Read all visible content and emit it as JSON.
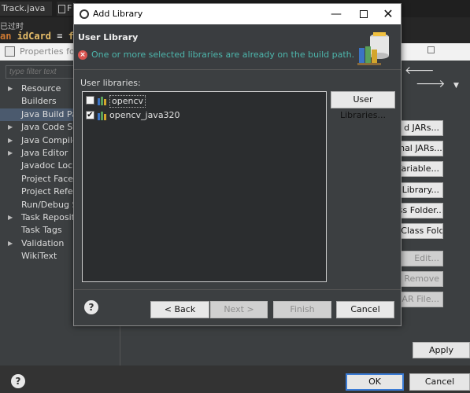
{
  "editor": {
    "tabs": [
      "Track.java",
      "F"
    ],
    "deprecated_text": "已过时",
    "code": {
      "keyword": "an",
      "identifier": "idCard",
      "operator": "=",
      "trail": "f"
    }
  },
  "properties_window": {
    "title": "Properties for",
    "filter_placeholder": "type filter text",
    "tree_items": [
      {
        "label": "Resource",
        "expandable": true,
        "selected": false
      },
      {
        "label": "Builders",
        "expandable": false,
        "selected": false
      },
      {
        "label": "Java Build Path",
        "expandable": false,
        "selected": true
      },
      {
        "label": "Java Code Style",
        "expandable": true,
        "selected": false
      },
      {
        "label": "Java Compiler",
        "expandable": true,
        "selected": false
      },
      {
        "label": "Java Editor",
        "expandable": true,
        "selected": false
      },
      {
        "label": "Javadoc Location",
        "expandable": false,
        "selected": false
      },
      {
        "label": "Project Facets",
        "expandable": false,
        "selected": false
      },
      {
        "label": "Project References",
        "expandable": false,
        "selected": false
      },
      {
        "label": "Run/Debug Settings",
        "expandable": false,
        "selected": false
      },
      {
        "label": "Task Repository",
        "expandable": true,
        "selected": false
      },
      {
        "label": "Task Tags",
        "expandable": false,
        "selected": false
      },
      {
        "label": "Validation",
        "expandable": true,
        "selected": false
      },
      {
        "label": "WikiText",
        "expandable": false,
        "selected": false
      }
    ],
    "side_buttons": [
      {
        "label": "d JARs...",
        "disabled": false
      },
      {
        "label": "ernal JARs...",
        "disabled": false
      },
      {
        "label": "Variable...",
        "disabled": false
      },
      {
        "label": "Library...",
        "disabled": false
      },
      {
        "label": "lass Folder...",
        "disabled": false
      },
      {
        "label": "al Class Folder...",
        "disabled": false
      },
      {
        "label": "Edit...",
        "disabled": true
      },
      {
        "label": "Remove",
        "disabled": true
      },
      {
        "label": "e JAR File...",
        "disabled": true
      }
    ],
    "apply_label": "Apply",
    "ok_label": "OK",
    "cancel_label": "Cancel"
  },
  "dialog": {
    "title": "Add Library",
    "heading": "User Library",
    "error_message": "One or more selected libraries are already on the build path.",
    "libraries_label": "User libraries:",
    "libraries": [
      {
        "name": "opencv",
        "checked": false
      },
      {
        "name": "opencv_java320",
        "checked": true
      }
    ],
    "user_libraries_button": "User Libraries...",
    "buttons": {
      "back": "< Back",
      "next": "Next >",
      "finish": "Finish",
      "cancel": "Cancel"
    }
  },
  "colors": {
    "dialog_bg": "#3c3f41",
    "error_text": "#4db6ac",
    "error_icon": "#d9534f",
    "selection": "#4b5a6e",
    "ok_border": "#3a7bd5"
  }
}
